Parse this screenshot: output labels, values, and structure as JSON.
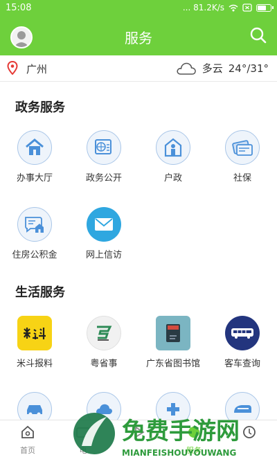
{
  "status": {
    "time": "15:08",
    "net": "... 81.2K/s"
  },
  "header": {
    "title": "服务"
  },
  "location": {
    "city": "广州",
    "weather": "多云",
    "temp": "24°/31°"
  },
  "sections": [
    {
      "title": "政务服务",
      "items": [
        {
          "label": "办事大厅",
          "icon": "house-icon"
        },
        {
          "label": "政务公开",
          "icon": "globe-doc-icon"
        },
        {
          "label": "户政",
          "icon": "person-house-icon"
        },
        {
          "label": "社保",
          "icon": "cards-icon"
        },
        {
          "label": "住房公积金",
          "icon": "housing-fund-icon"
        },
        {
          "label": "网上信访",
          "icon": "mail-icon"
        }
      ]
    },
    {
      "title": "生活服务",
      "items": [
        {
          "label": "米斗报料",
          "icon": "midou-app-icon"
        },
        {
          "label": "粤省事",
          "icon": "yueshengshi-app-icon"
        },
        {
          "label": "广东省图书馆",
          "icon": "library-book-icon"
        },
        {
          "label": "客车查询",
          "icon": "bus-icon"
        }
      ]
    }
  ],
  "tabs": [
    {
      "label": "首页",
      "icon": "home-icon"
    },
    {
      "label": "电",
      "icon": "tv-icon"
    },
    {
      "label": "",
      "icon": "play-icon"
    },
    {
      "label": "服务",
      "icon": "service-icon"
    },
    {
      "label": "",
      "icon": "user-icon"
    }
  ],
  "watermark": {
    "title": "免费手游网",
    "subtitle": "MIANFEISHOUYOUWANG"
  },
  "colors": {
    "brand": "#6ed03c",
    "icon_blue": "#4a90d9",
    "tab_active": "#6ed03c"
  }
}
